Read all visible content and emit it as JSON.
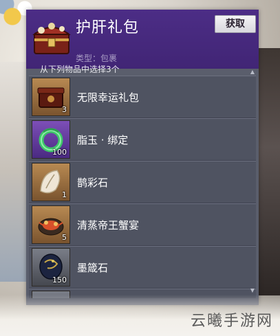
{
  "dialog": {
    "title": "护肝礼包",
    "type_label": "类型：包裹",
    "get_button": "获取",
    "subtitle": "从下列物品中选择3个"
  },
  "items": [
    {
      "name": "无限幸运礼包",
      "qty": "3",
      "icon": "treasure-box-icon",
      "frame": "orange"
    },
    {
      "name": "脂玉 · 绑定",
      "qty": "100",
      "icon": "jade-ring-icon",
      "frame": "purple"
    },
    {
      "name": "鹊彩石",
      "qty": "1",
      "icon": "feather-stone-icon",
      "frame": "orange"
    },
    {
      "name": "清蒸帝王蟹宴",
      "qty": "5",
      "icon": "crab-feast-icon",
      "frame": "orange"
    },
    {
      "name": "墨箴石",
      "qty": "150",
      "icon": "ink-stone-icon",
      "frame": "gray"
    }
  ],
  "watermark": "云曦手游网",
  "colors": {
    "header": "#4c2d86",
    "panel": "#5a5e6c",
    "row": "#4f5361"
  }
}
